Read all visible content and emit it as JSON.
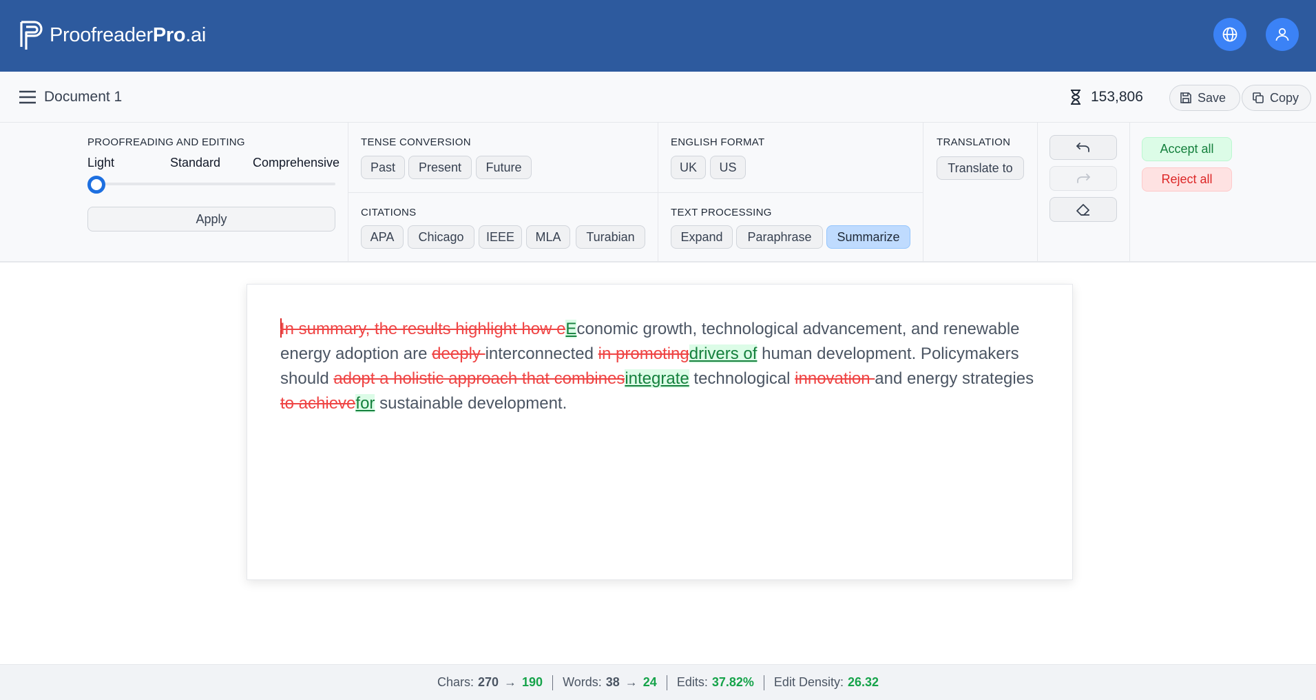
{
  "app": {
    "brand_regular": "Proofreader",
    "brand_bold": "Pro",
    "brand_suffix": ".ai",
    "colors": {
      "header": "#2d5a9e",
      "accent": "#3b82f6",
      "insert": "#15803d",
      "delete": "#ef4444"
    }
  },
  "docbar": {
    "title": "Document 1",
    "credits": "153,806",
    "save_label": "Save",
    "copy_label": "Copy"
  },
  "tools": {
    "proofreading": {
      "title": "PROOFREADING AND EDITING",
      "levels": [
        "Light",
        "Standard",
        "Comprehensive"
      ],
      "selected_level": "Light",
      "apply_label": "Apply"
    },
    "tense": {
      "title": "TENSE CONVERSION",
      "options": [
        "Past",
        "Present",
        "Future"
      ]
    },
    "citations": {
      "title": "CITATIONS",
      "options": [
        "APA",
        "Chicago",
        "IEEE",
        "MLA",
        "Turabian"
      ]
    },
    "english": {
      "title": "ENGLISH FORMAT",
      "options": [
        "UK",
        "US"
      ]
    },
    "processing": {
      "title": "TEXT PROCESSING",
      "options": [
        "Expand",
        "Paraphrase",
        "Summarize"
      ],
      "active": "Summarize"
    },
    "translation": {
      "title": "TRANSLATION",
      "button": "Translate to"
    },
    "accept_all": "Accept all",
    "reject_all": "Reject all"
  },
  "document": {
    "segments": [
      {
        "type": "del",
        "text": "In summary, the results highlight how e"
      },
      {
        "type": "ins",
        "text": "E"
      },
      {
        "type": "text",
        "text": "conomic growth, technological advancement, and renewable energy adoption are "
      },
      {
        "type": "del",
        "text": "deeply "
      },
      {
        "type": "text",
        "text": "interconnected "
      },
      {
        "type": "del",
        "text": "in promoting"
      },
      {
        "type": "ins",
        "text": "drivers of"
      },
      {
        "type": "text",
        "text": " human development. Policymakers should "
      },
      {
        "type": "del",
        "text": "adopt a holistic approach that combines"
      },
      {
        "type": "ins",
        "text": "integrate"
      },
      {
        "type": "text",
        "text": " technological "
      },
      {
        "type": "del",
        "text": "innovation "
      },
      {
        "type": "text",
        "text": "and energy strategies "
      },
      {
        "type": "del",
        "text": "to achieve"
      },
      {
        "type": "ins",
        "text": "for"
      },
      {
        "type": "text",
        "text": " sustainable development."
      }
    ]
  },
  "stats": {
    "chars_label": "Chars:",
    "chars_before": "270",
    "chars_after": "190",
    "words_label": "Words:",
    "words_before": "38",
    "words_after": "24",
    "edits_label": "Edits:",
    "edits_value": "37.82%",
    "density_label": "Edit Density:",
    "density_value": "26.32"
  }
}
